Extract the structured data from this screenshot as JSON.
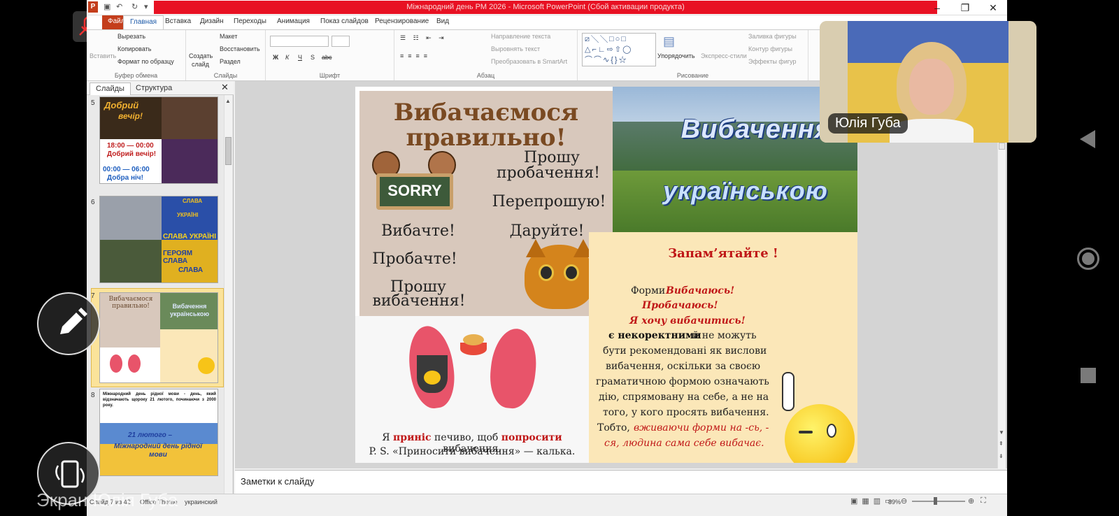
{
  "window": {
    "title": "Міжнародний день РМ 2026 - Microsoft PowerPoint (Сбой активации продукта)",
    "file_tab": "Файл"
  },
  "tabs": [
    "Главная",
    "Вставка",
    "Дизайн",
    "Переходы",
    "Анимация",
    "Показ слайдов",
    "Рецензирование",
    "Вид"
  ],
  "ribbon": {
    "clipboard": {
      "paste": "Вставить",
      "cut": "Вырезать",
      "copy": "Копировать",
      "format_painter": "Формат по образцу",
      "group": "Буфер обмена"
    },
    "slides": {
      "new_slide": "Создать",
      "new_slide2": "слайд",
      "layout": "Макет",
      "reset": "Восстановить",
      "section": "Раздел",
      "group": "Слайды"
    },
    "font": {
      "group": "Шрифт",
      "bold": "Ж",
      "italic": "К",
      "underline": "Ч",
      "shadow": "S",
      "strike": "abc"
    },
    "paragraph": {
      "text_direction": "Направление текста",
      "align_text": "Выровнять текст",
      "smartart": "Преобразовать в SmartArt",
      "group": "Абзац"
    },
    "drawing": {
      "arrange": "Упорядочить",
      "quick_styles": "Экспресс-стили",
      "fill": "Заливка фигуры",
      "outline": "Контур фигуры",
      "effects": "Эффекты фигур",
      "group": "Рисование"
    }
  },
  "left_panel": {
    "tab_slides": "Слайды",
    "tab_outline": "Структура",
    "thumbs": [
      {
        "num": "5",
        "t1": "Добрий",
        "t2": "вечір!",
        "l1": "18:00 — 00:00",
        "l2": "Добрий вечір!",
        "l3": "00:00 — 06:00",
        "l4": "Добра ніч!"
      },
      {
        "num": "6",
        "t1": "СЛАВА",
        "t2": "УКРАЇНІ",
        "l1": "СЛАВА УКРАЇНІ",
        "l2": "ГЕРОЯМ СЛАВА",
        "l3": "СЛАВА"
      },
      {
        "num": "7",
        "t1": "Вибачаємося правильно!",
        "t2": "Вибачення українською"
      },
      {
        "num": "8",
        "text": "Міжнародний день рідної мови - день, який відзначають щороку 21 лютого, починаючи з 2000 року.",
        "t1": "21 лютого –",
        "t2": "Міжнародний день рідної мови"
      }
    ]
  },
  "slide": {
    "title1": "Вибачаємося",
    "title2": "правильно!",
    "sorry": "SORRY",
    "p1a": "Прошу",
    "p1b": "пробачення!",
    "p2": "Перепрошую!",
    "p3": "Вибачте!",
    "p4": "Даруйте!",
    "p5": "Пробачте!",
    "p6a": "Прошу",
    "p6b": "вибачення!",
    "banner1": "Вибачення",
    "banner2": "українською",
    "remember": "Запам’ятайте !",
    "forms_label": "Форми",
    "form1": "Вибачаюсь!",
    "form2": "Пробачаюсь!",
    "form3": "Я хочу вибачитись!",
    "incorrect": "є некоректними",
    "body1": "й не можуть",
    "body2": "бути рекомендовані як вислови",
    "body3": "вибачення, оскільки за своєю",
    "body4": "граматичною формою означають",
    "body5": "дію, спрямовану на себе, а не на",
    "body6": "того, у кого просять вибачення.",
    "body7": "Тобто,",
    "body7b": "вживаючи форми на -сь, -",
    "body8": "ся, людина сама себе вибачає.",
    "bottom1a": "Я",
    "bottom1b": "приніс",
    "bottom1c": "печиво, щоб",
    "bottom1d": "попросити",
    "bottom1e": "вибачення.",
    "bottom2": "P. S. «Приносити вибачення» — калька."
  },
  "notes_placeholder": "Заметки к слайду",
  "status": {
    "slide_of": "Слайд 7 из 42",
    "theme": "Office Theme",
    "language": "украинский",
    "zoom": "89%"
  },
  "video": {
    "name": "Юлія Губа"
  },
  "overlay": {
    "screen_label": "Экран Юлія Губа"
  }
}
